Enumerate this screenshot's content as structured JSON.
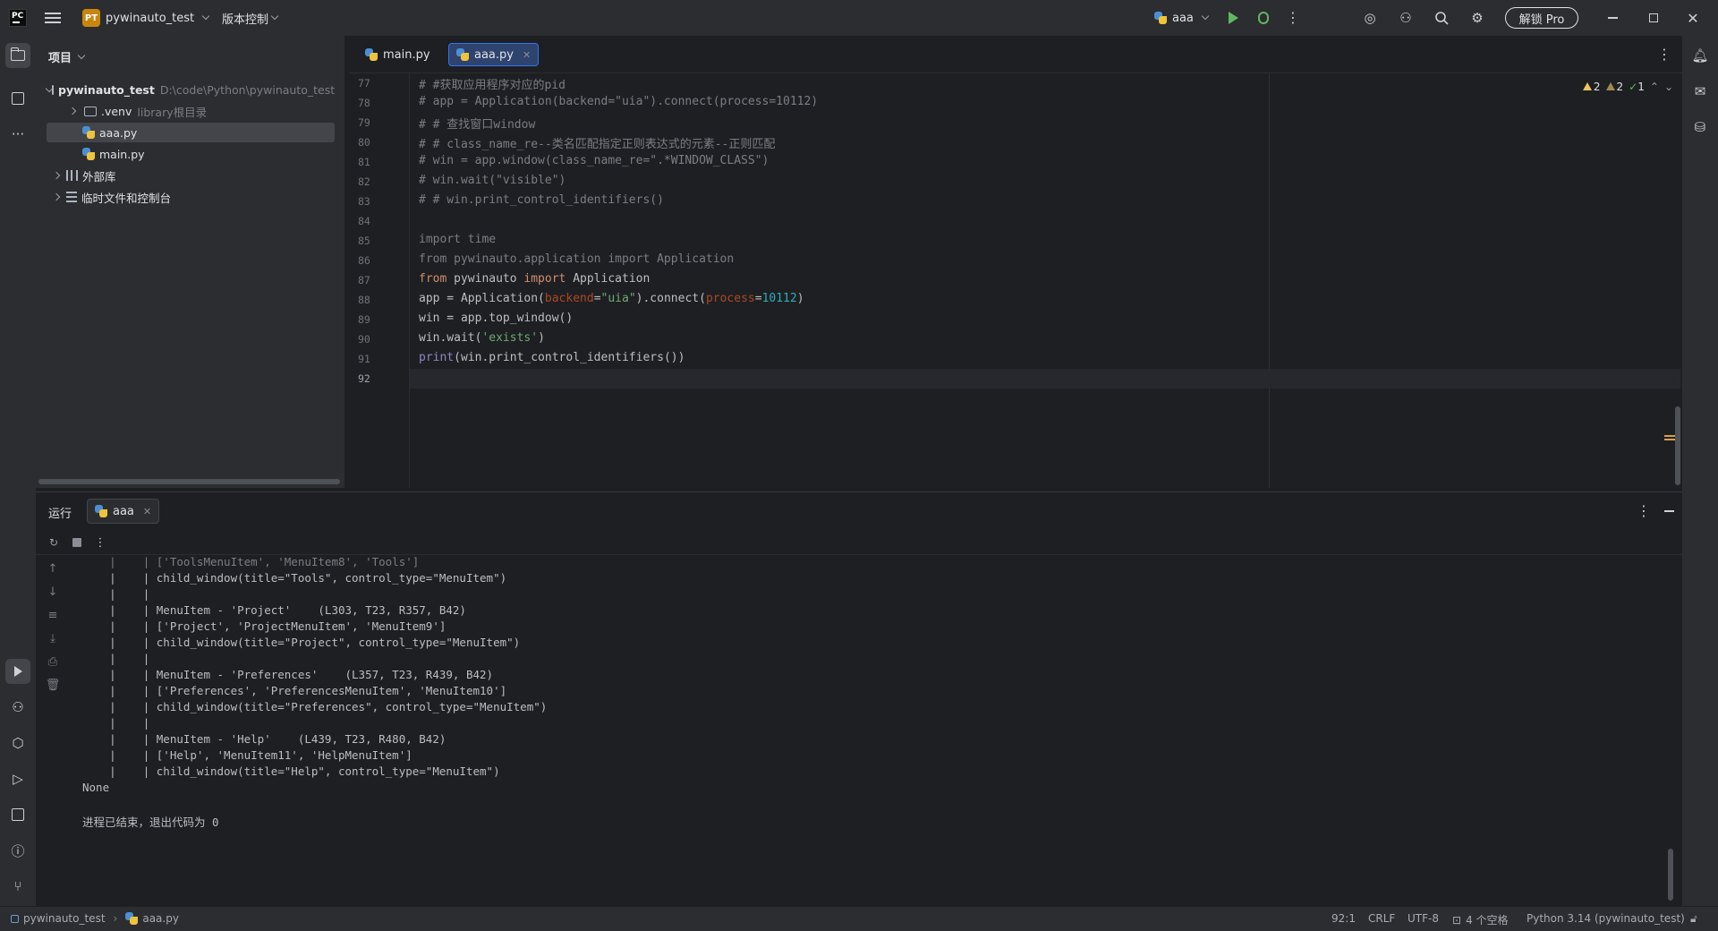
{
  "titlebar": {
    "project_badge": "PT",
    "project_name": "pywinauto_test",
    "vcs_label": "版本控制",
    "run_config": "aaa",
    "pro_button": "解锁 Pro"
  },
  "project_panel": {
    "title": "项目",
    "tree": [
      {
        "label": "pywinauto_test",
        "hint": "D:\\code\\Python\\pywinauto_test"
      },
      {
        "label": ".venv",
        "hint": "library根目录"
      },
      {
        "label": "aaa.py"
      },
      {
        "label": "main.py"
      },
      {
        "label": "外部库"
      },
      {
        "label": "临时文件和控制台"
      }
    ]
  },
  "editor": {
    "tabs": [
      {
        "label": "main.py"
      },
      {
        "label": "aaa.py"
      }
    ],
    "inspections": {
      "warnings": "2",
      "weak_warnings": "2",
      "ok": "1"
    },
    "line_numbers": [
      "77",
      "78",
      "79",
      "80",
      "81",
      "82",
      "83",
      "84",
      "85",
      "86",
      "87",
      "88",
      "89",
      "90",
      "91",
      "92"
    ]
  },
  "run_panel": {
    "title": "运行",
    "tab_label": "aaa",
    "console_lines": [
      "    |    | child_window(title=\"Tools\", control_type=\"MenuItem\")",
      "    |    |",
      "    |    | MenuItem - 'Project'    (L303, T23, R357, B42)",
      "    |    | ['Project', 'ProjectMenuItem', 'MenuItem9']",
      "    |    | child_window(title=\"Project\", control_type=\"MenuItem\")",
      "    |    |",
      "    |    | MenuItem - 'Preferences'    (L357, T23, R439, B42)",
      "    |    | ['Preferences', 'PreferencesMenuItem', 'MenuItem10']",
      "    |    | child_window(title=\"Preferences\", control_type=\"MenuItem\")",
      "    |    |",
      "    |    | MenuItem - 'Help'    (L439, T23, R480, B42)",
      "    |    | ['Help', 'MenuItem11', 'HelpMenuItem']",
      "    |    | child_window(title=\"Help\", control_type=\"MenuItem\")",
      "None",
      "",
      "进程已结束，退出代码为 0"
    ]
  },
  "statusbar": {
    "breadcrumb_project": "pywinauto_test",
    "breadcrumb_file": "aaa.py",
    "position": "92:1",
    "line_ending": "CRLF",
    "encoding": "UTF-8",
    "indent": "4 个空格",
    "interpreter": "Python 3.14 (pywinauto_test)"
  },
  "colors": {
    "accent": "#3574f0",
    "warning": "#f2c55c",
    "ok": "#5fb85f",
    "project_badge": "#c9860e"
  }
}
